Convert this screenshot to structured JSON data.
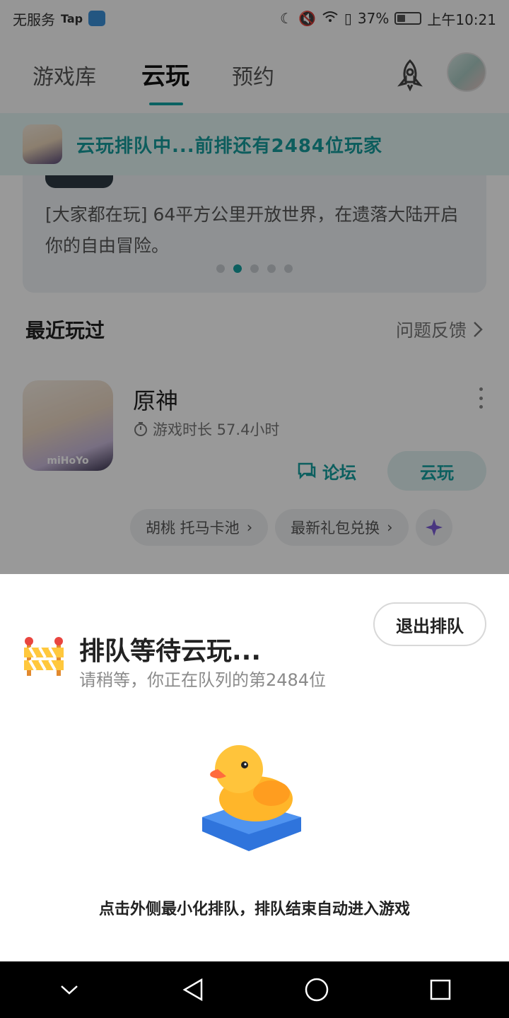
{
  "status_bar": {
    "carrier": "无服务",
    "tap_label": "Tap",
    "battery_percent": "37%",
    "battery_level": 0.37,
    "time": "上午10:21"
  },
  "header": {
    "tabs": [
      {
        "label": "游戏库",
        "active": false
      },
      {
        "label": "云玩",
        "active": true
      },
      {
        "label": "预约",
        "active": false
      }
    ],
    "rocket_icon": "rocket-icon",
    "avatar_icon": "avatar"
  },
  "queue_banner": {
    "text": "云玩排队中...前排还有2484位玩家"
  },
  "featured": {
    "description": "[大家都在玩] 64平方公里开放世界，在遗落大陆开启你的自由冒险。",
    "dots": 5,
    "active_dot": 1
  },
  "recent": {
    "title": "最近玩过",
    "feedback": "问题反馈",
    "game": {
      "name": "原神",
      "play_time": "游戏时长 57.4小时",
      "icon_brand": "miHoYo",
      "forum_label": "论坛",
      "cloud_label": "云玩"
    },
    "chips": [
      "胡桃 托马卡池",
      "最新礼包兑换"
    ]
  },
  "sheet": {
    "title": "排队等待云玩...",
    "subtitle": "请稍等，你正在队列的第2484位",
    "exit_label": "退出排队",
    "hint": "点击外侧最小化排队，排队结束自动进入游戏"
  },
  "colors": {
    "accent": "#159f9f",
    "banner_bg": "#e1f3f2",
    "overlay": "rgba(0,0,0,0.40)"
  }
}
